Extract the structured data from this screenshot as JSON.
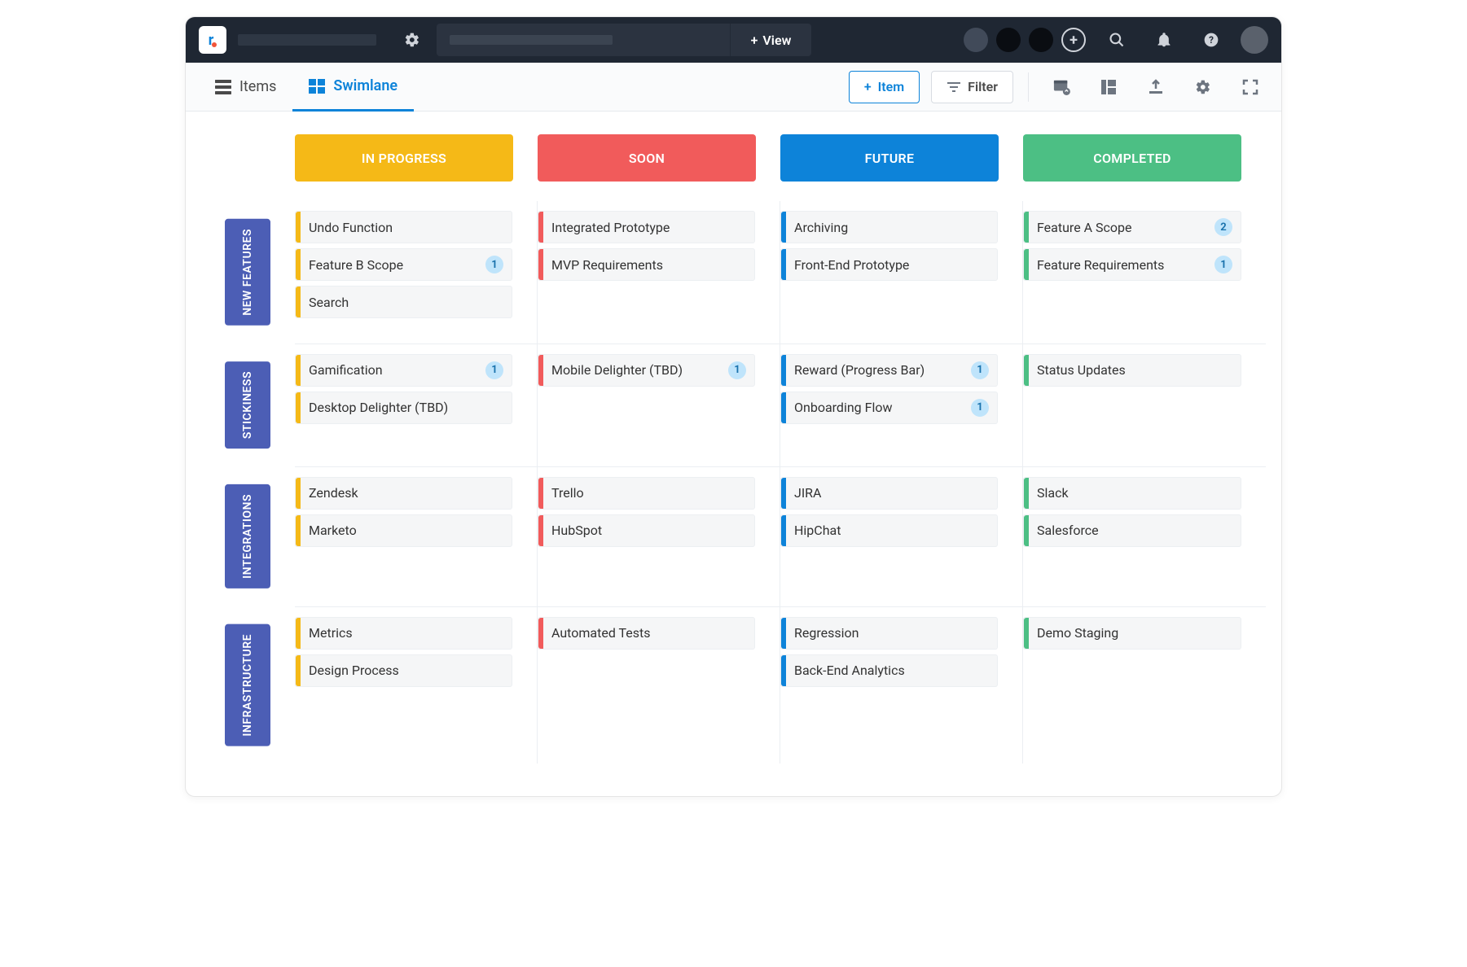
{
  "topbar": {
    "view_label": "View"
  },
  "toolbar": {
    "tabs": {
      "items_label": "Items",
      "swimlane_label": "Swimlane"
    },
    "buttons": {
      "add_item_label": "Item",
      "filter_label": "Filter"
    }
  },
  "columns": [
    {
      "id": "in_progress",
      "label": "IN PROGRESS",
      "color": "c-yellow",
      "stripe": "s-yellow"
    },
    {
      "id": "soon",
      "label": "SOON",
      "color": "c-red",
      "stripe": "s-red"
    },
    {
      "id": "future",
      "label": "FUTURE",
      "color": "c-blue",
      "stripe": "s-blue"
    },
    {
      "id": "completed",
      "label": "COMPLETED",
      "color": "c-green",
      "stripe": "s-green"
    }
  ],
  "lanes": [
    {
      "label": "NEW FEATURES",
      "cells": [
        [
          {
            "title": "Undo Function"
          },
          {
            "title": "Feature B Scope",
            "badge": 1
          },
          {
            "title": "Search"
          }
        ],
        [
          {
            "title": "Integrated Prototype"
          },
          {
            "title": "MVP Requirements"
          }
        ],
        [
          {
            "title": "Archiving"
          },
          {
            "title": "Front-End Prototype"
          }
        ],
        [
          {
            "title": "Feature A Scope",
            "badge": 2
          },
          {
            "title": "Feature Requirements",
            "badge": 1
          }
        ]
      ]
    },
    {
      "label": "STICKINESS",
      "cells": [
        [
          {
            "title": "Gamification",
            "badge": 1
          },
          {
            "title": "Desktop Delighter (TBD)"
          }
        ],
        [
          {
            "title": "Mobile Delighter (TBD)",
            "badge": 1
          }
        ],
        [
          {
            "title": "Reward (Progress Bar)",
            "badge": 1
          },
          {
            "title": "Onboarding Flow",
            "badge": 1
          }
        ],
        [
          {
            "title": "Status Updates"
          }
        ]
      ]
    },
    {
      "label": "INTEGRATIONS",
      "cells": [
        [
          {
            "title": "Zendesk"
          },
          {
            "title": "Marketo"
          }
        ],
        [
          {
            "title": "Trello"
          },
          {
            "title": "HubSpot"
          }
        ],
        [
          {
            "title": "JIRA"
          },
          {
            "title": "HipChat"
          }
        ],
        [
          {
            "title": "Slack"
          },
          {
            "title": "Salesforce"
          }
        ]
      ]
    },
    {
      "label": "INFRASTRUCTURE",
      "cells": [
        [
          {
            "title": "Metrics"
          },
          {
            "title": "Design Process"
          }
        ],
        [
          {
            "title": "Automated Tests"
          }
        ],
        [
          {
            "title": "Regression"
          },
          {
            "title": "Back-End Analytics"
          }
        ],
        [
          {
            "title": "Demo Staging"
          }
        ]
      ]
    }
  ]
}
